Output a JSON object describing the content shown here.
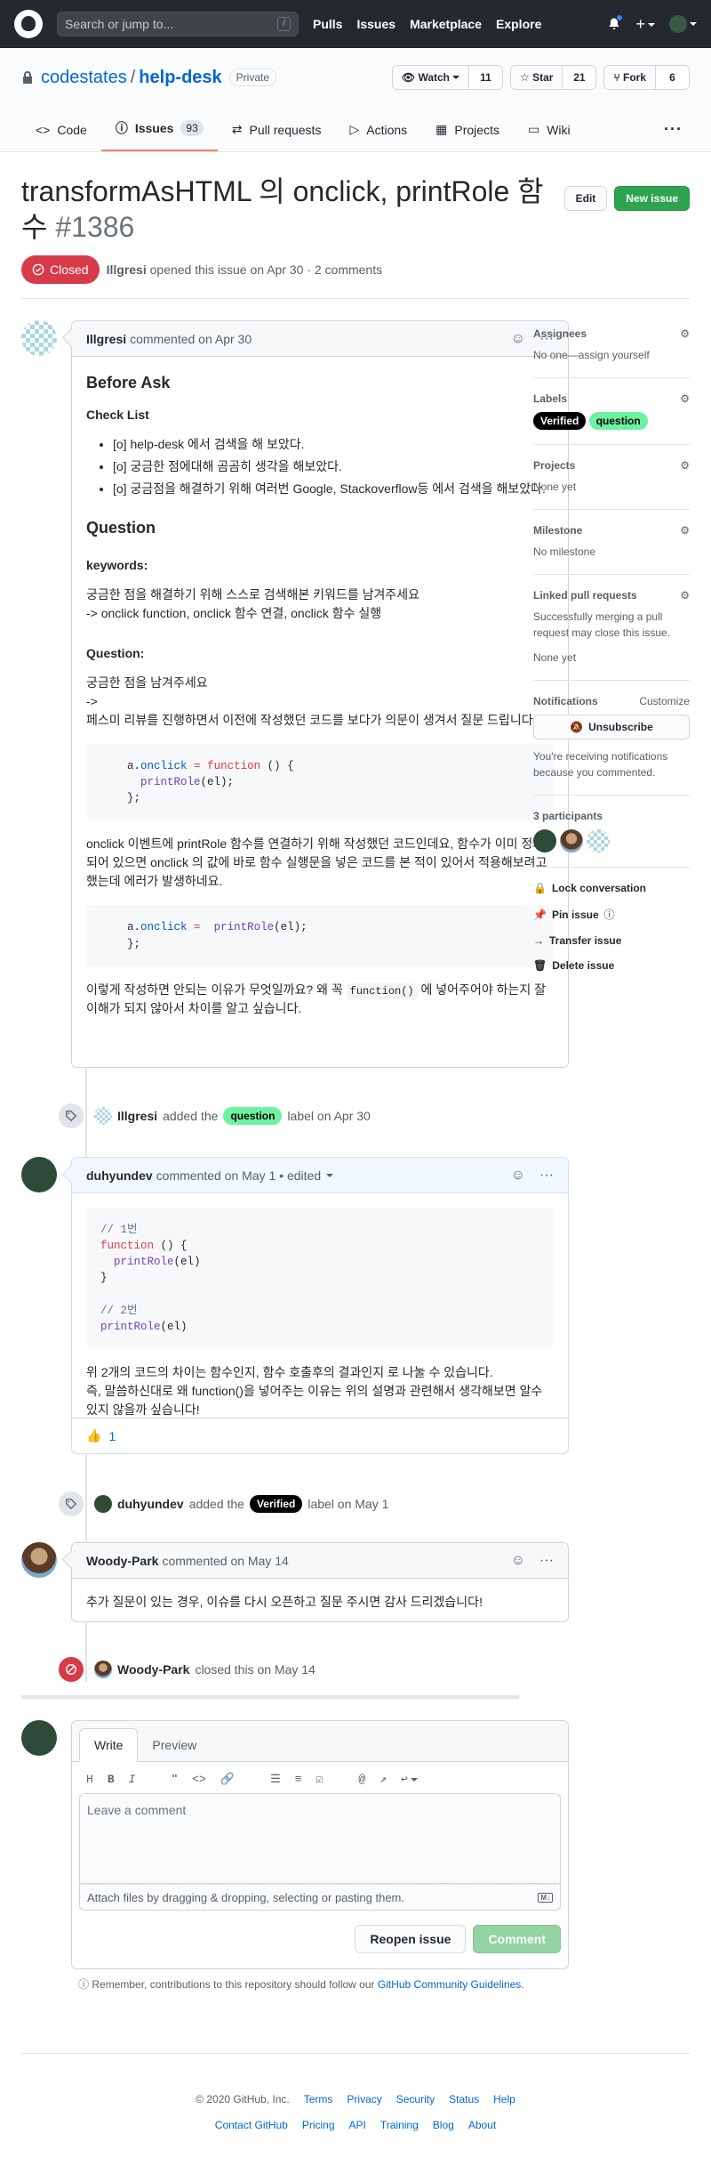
{
  "topbar": {
    "search_placeholder": "Search or jump to...",
    "slash": "/",
    "nav": [
      "Pulls",
      "Issues",
      "Marketplace",
      "Explore"
    ]
  },
  "repo": {
    "owner": "codestates",
    "name": "help-desk",
    "visibility": "Private",
    "watch_label": "Watch",
    "watch_count": "11",
    "star_label": "Star",
    "star_count": "21",
    "fork_label": "Fork",
    "fork_count": "6",
    "tabs": [
      {
        "label": "Code"
      },
      {
        "label": "Issues",
        "count": "93"
      },
      {
        "label": "Pull requests"
      },
      {
        "label": "Actions"
      },
      {
        "label": "Projects"
      },
      {
        "label": "Wiki"
      }
    ]
  },
  "issue": {
    "title": "transformAsHTML 의 onclick, printRole 함수",
    "number": "#1386",
    "edit_label": "Edit",
    "new_issue_label": "New issue",
    "state": "Closed",
    "author": "Illgresi",
    "meta": "opened this issue on Apr 30 · 2 comments"
  },
  "comments": {
    "first": {
      "author": "Illgresi",
      "meta": "commented on Apr 30",
      "h_before": "Before Ask",
      "h_checklist": "Check List",
      "checklist": [
        "[o] help-desk 에서 검색을 해 보았다.",
        "[o] 궁금한 점에대해 곰곰히 생각을 해보았다.",
        "[o] 궁금점을 해결하기 위해 여러번 Google, Stackoverflow등 에서 검색을 해보았다."
      ],
      "h_question": "Question",
      "h_keywords": "keywords:",
      "keywords_1": "궁금한 점을 해결하기 위해 스스로 검색해본 키워드를 남겨주세요",
      "keywords_2": "-> onclick function, onclick 함수 연결, onclick 함수 실행",
      "h_question2": "Question:",
      "question_1": "궁금한 점을 남겨주세요",
      "question_2": "->",
      "question_3": "페스미 리뷰를 진행하면서 이전에 작성했던 코드를 보다가 의문이 생겨서 질문 드립니다.",
      "para_2": "onclick 이벤트에 printRole 함수를 연결하기 위해 작성했던 코드인데요, 함수가 이미 정의되어 있으면 onclick 의 값에 바로 함수 실행문을 넣은 코드를 본 적이 있어서 적용해보려고 했는데 에러가 발생하네요.",
      "para_3a": "이렇게 작성하면 안되는 이유가 무엇일까요? 왜 꼭",
      "para_3_code": "function()",
      "para_3b": "에 넣어주어야 하는지 잘 이해가 되지 않아서 차이를 알고 싶습니다."
    },
    "event1": {
      "actor": "Illgresi",
      "pre": "added the",
      "label": "question",
      "post": "label on Apr 30"
    },
    "second": {
      "author": "duhyundev",
      "meta": "commented on May 1 • edited",
      "code_c1": "// 1번",
      "code_c2": "// 2번",
      "para_1": "위 2개의 코드의 차이는 함수인지, 함수 호출후의 결과인지 로 나눌 수 있습니다.",
      "para_2": "즉, 말씀하신대로 왜 function()을 넣어주는 이유는 위의 설명과 관련해서 생각해보면 알수 있지 않을까 싶습니다!",
      "reaction_count": "1"
    },
    "event2": {
      "actor": "duhyundev",
      "pre": "added the",
      "label": "Verified",
      "post": "label on May 1"
    },
    "third": {
      "author": "Woody-Park",
      "meta": "commented on May 14",
      "body": "추가 질문이 있는 경우, 이슈를 다시 오픈하고 질문 주시면 감사 드리겠습니다!"
    },
    "event3": {
      "actor": "Woody-Park",
      "text": "closed this on May 14"
    }
  },
  "new_comment": {
    "tab_write": "Write",
    "tab_preview": "Preview",
    "placeholder": "Leave a comment",
    "attach": "Attach files by dragging & dropping, selecting or pasting them.",
    "reopen": "Reopen issue",
    "submit": "Comment",
    "remember": "Remember, contributions to this repository should follow our",
    "guidelines": "GitHub Community Guidelines."
  },
  "sidebar": {
    "assignees_h": "Assignees",
    "assignees_v": "No one—assign yourself",
    "labels_h": "Labels",
    "labels": [
      "Verified",
      "question"
    ],
    "projects_h": "Projects",
    "projects_v": "None yet",
    "milestone_h": "Milestone",
    "milestone_v": "No milestone",
    "linked_h": "Linked pull requests",
    "linked_desc": "Successfully merging a pull request may close this issue.",
    "linked_v": "None yet",
    "notif_h": "Notifications",
    "customize": "Customize",
    "unsubscribe": "Unsubscribe",
    "notif_desc": "You're receiving notifications because you commented.",
    "participants_h": "3 participants",
    "lock": "Lock conversation",
    "pin": "Pin issue",
    "transfer": "Transfer issue",
    "delete": "Delete issue"
  },
  "footer": {
    "copyright": "© 2020 GitHub, Inc.",
    "row1": [
      "Terms",
      "Privacy",
      "Security",
      "Status",
      "Help"
    ],
    "row2": [
      "Contact GitHub",
      "Pricing",
      "API",
      "Training",
      "Blog",
      "About"
    ]
  },
  "colors": {
    "brand": "#24292e",
    "link": "#0366d6",
    "closed": "#d73a49",
    "green": "#2ea44f",
    "label_question": "#6df2a1",
    "label_verified": "#000000"
  }
}
